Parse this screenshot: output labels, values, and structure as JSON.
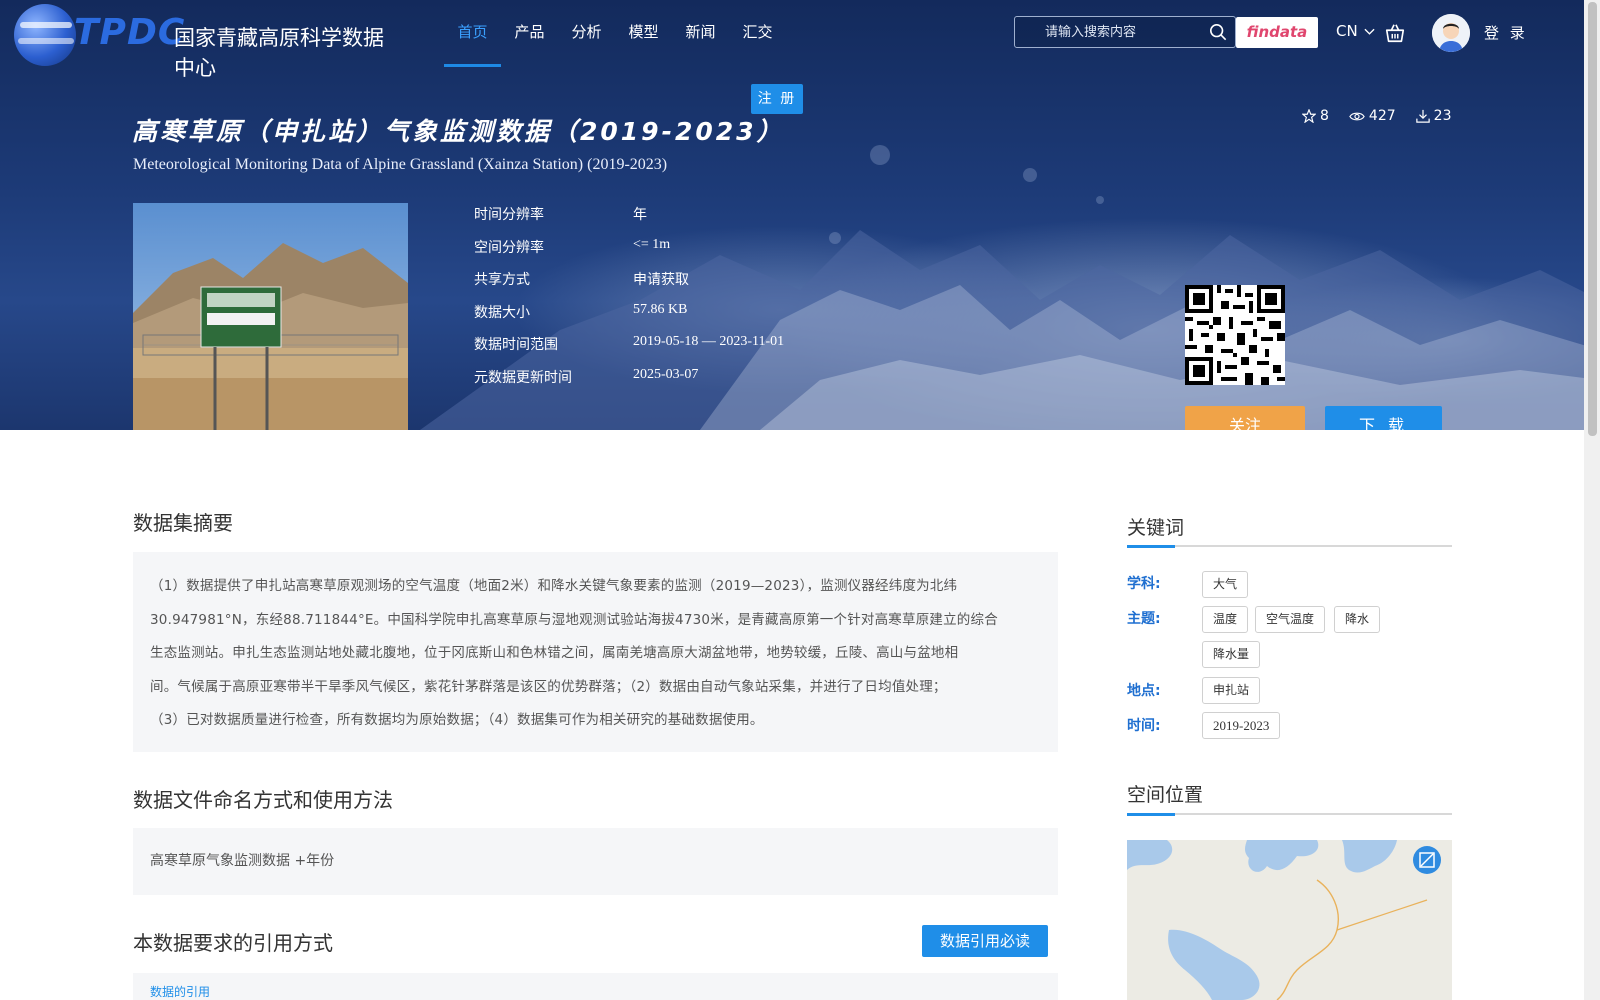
{
  "header": {
    "logo_text": "TPDC",
    "logo_cn": "国家青藏高原科学数据中心",
    "nav": [
      {
        "label": "首页"
      },
      {
        "label": "产品"
      },
      {
        "label": "分析"
      },
      {
        "label": "模型"
      },
      {
        "label": "新闻"
      },
      {
        "label": "汇交"
      }
    ],
    "search_placeholder": "请输入搜索内容",
    "findata_label": "findata",
    "lang_label": "CN",
    "login_label": "登 录",
    "register_label": "注 册"
  },
  "dataset": {
    "title_cn": "高寒草原（申扎站）气象监测数据（2019-2023）",
    "title_en": "Meteorological Monitoring Data of Alpine Grassland (Xainza Station) (2019-2023)",
    "stats": {
      "stars": "8",
      "views": "427",
      "downloads": "23"
    },
    "meta": [
      {
        "label": "时间分辨率",
        "value": "年"
      },
      {
        "label": "空间分辨率",
        "value": "<= 1m"
      },
      {
        "label": "共享方式",
        "value": "申请获取"
      },
      {
        "label": "数据大小",
        "value": "57.86 KB"
      },
      {
        "label": "数据时间范围",
        "value": "2019-05-18 — 2023-11-01"
      },
      {
        "label": "元数据更新时间",
        "value": "2025-03-07"
      }
    ],
    "follow_label": "关注",
    "download_label": "下 载"
  },
  "abstract": {
    "heading": "数据集摘要",
    "lines": [
      "（1）数据提供了申扎站高寒草原观测场的空气温度（地面2米）和降水关键气象要素的监测（2019—2023），监测仪器经纬度为北纬",
      "30.947981°N，东经88.711844°E。中国科学院申扎高寒草原与湿地观测试验站海拔4730米，是青藏高原第一个针对高寒草原建立的综合",
      "生态监测站。申扎生态监测站地处藏北腹地，位于冈底斯山和色林错之间，属南羌塘高原大湖盆地带，地势较缓，丘陵、高山与盆地相",
      "间。气候属于高原亚寒带半干旱季风气候区，紫花针茅群落是该区的优势群落；（2）数据由自动气象站采集，并进行了日均值处理；",
      "（3）已对数据质量进行检查，所有数据均为原始数据；（4）数据集可作为相关研究的基础数据使用。"
    ]
  },
  "naming": {
    "heading": "数据文件命名方式和使用方法",
    "text": "高寒草原气象监测数据 +年份"
  },
  "citation": {
    "heading": "本数据要求的引用方式",
    "button_label": "数据引用必读",
    "link_label": "数据的引用"
  },
  "keywords": {
    "heading": "关键词",
    "groups": [
      {
        "label": "学科:",
        "tags": [
          "大气"
        ]
      },
      {
        "label": "主题:",
        "tags": [
          "温度",
          "空气温度",
          "降水",
          "降水量"
        ]
      },
      {
        "label": "地点:",
        "tags": [
          "申扎站"
        ]
      },
      {
        "label": "时间:",
        "tags": [
          "2019-2023"
        ]
      }
    ]
  },
  "location": {
    "heading": "空间位置"
  },
  "colors": {
    "accent": "#1f8ee8",
    "follow": "#f0a348",
    "hero": "#1d3b78"
  }
}
